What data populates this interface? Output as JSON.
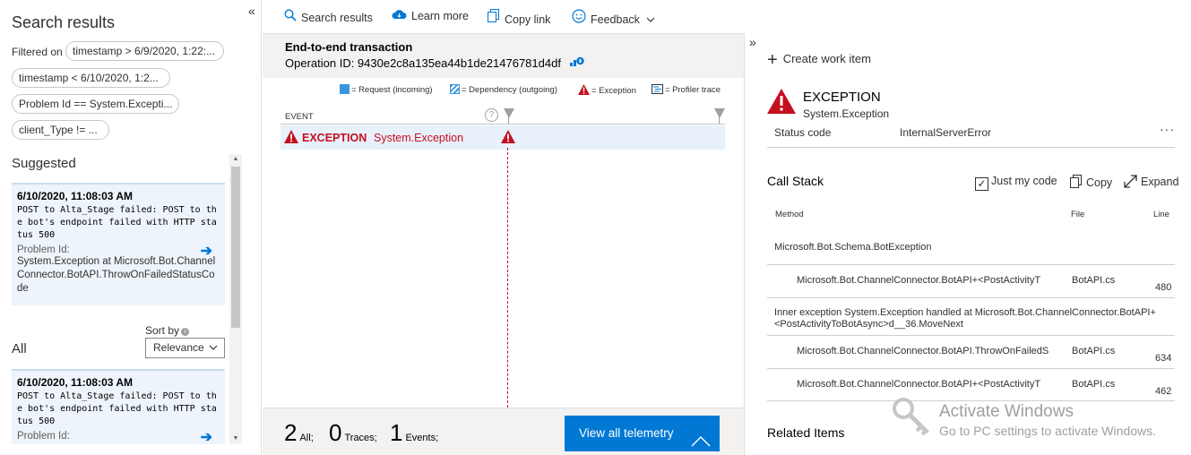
{
  "left_pane": {
    "title": "Search results",
    "filtered_on_label": "Filtered on",
    "filters": [
      "timestamp > 6/9/2020, 1:22:...",
      "timestamp < 6/10/2020, 1:2...",
      "Problem Id == System.Excepti...",
      "client_Type != ..."
    ],
    "suggested_label": "Suggested",
    "all_label": "All",
    "sort_by_label": "Sort by",
    "sort_value": "Relevance",
    "suggested_result": {
      "timestamp": "6/10/2020, 11:08:03 AM",
      "message": "POST to Alta_Stage failed: POST to the bot's endpoint failed with HTTP status 500",
      "problem_id_label": "Problem Id:",
      "problem_id": "System.Exception at Microsoft.Bot.ChannelConnector.BotAPI.ThrowOnFailedStatusCode"
    },
    "all_result": {
      "timestamp": "6/10/2020, 11:08:03 AM",
      "message": "POST to Alta_Stage failed: POST to the bot's endpoint failed with HTTP status 500",
      "problem_id_label": "Problem Id:"
    }
  },
  "toolbar": {
    "search_results": "Search results",
    "learn_more": "Learn more",
    "copy_link": "Copy link",
    "feedback": "Feedback"
  },
  "transaction": {
    "title": "End-to-end transaction",
    "operation_id": "Operation ID: 9430e2c8a135ea44b1de21476781d4df",
    "legend": {
      "request": "= Request (incoming)",
      "dependency": "= Dependency (outgoing)",
      "exception": "= Exception",
      "profiler": "= Profiler trace"
    },
    "event_column": "EVENT",
    "event_row": {
      "label": "EXCEPTION",
      "type": "System.Exception"
    },
    "counts": {
      "all_n": "2",
      "all_label": "All;",
      "traces_n": "0",
      "traces_label": "Traces;",
      "events_n": "1",
      "events_label": "Events;"
    },
    "view_all_button": "View all telemetry"
  },
  "details": {
    "create_work_item": "Create work item",
    "exception_title": "EXCEPTION",
    "exception_type": "System.Exception",
    "status_code_label": "Status code",
    "status_code_value": "InternalServerError",
    "call_stack_title": "Call Stack",
    "just_my_code": "Just my code",
    "copy": "Copy",
    "expand": "Expand",
    "columns": {
      "method": "Method",
      "file": "File",
      "line": "Line"
    },
    "stack": [
      {
        "method": "Microsoft.Bot.Schema.BotException",
        "file": "",
        "line": ""
      },
      {
        "method": "Microsoft.Bot.ChannelConnector.BotAPI+<PostActivityT",
        "file": "BotAPI.cs",
        "line": "480"
      },
      {
        "method": "Inner exception System.Exception handled at Microsoft.Bot.ChannelConnector.BotAPI+<PostActivityToBotAsync>d__36.MoveNext",
        "file": "",
        "line": ""
      },
      {
        "method": "Microsoft.Bot.ChannelConnector.BotAPI.ThrowOnFailedS",
        "file": "BotAPI.cs",
        "line": "634"
      },
      {
        "method": "Microsoft.Bot.ChannelConnector.BotAPI+<PostActivityT",
        "file": "BotAPI.cs",
        "line": "462"
      }
    ],
    "related_items": "Related Items"
  },
  "watermark": {
    "line1": "Activate Windows",
    "line2": "Go to PC settings to activate Windows."
  },
  "colors": {
    "accent": "#0078d4",
    "error": "#c50f1f",
    "selected_row": "#e8f1fa"
  }
}
